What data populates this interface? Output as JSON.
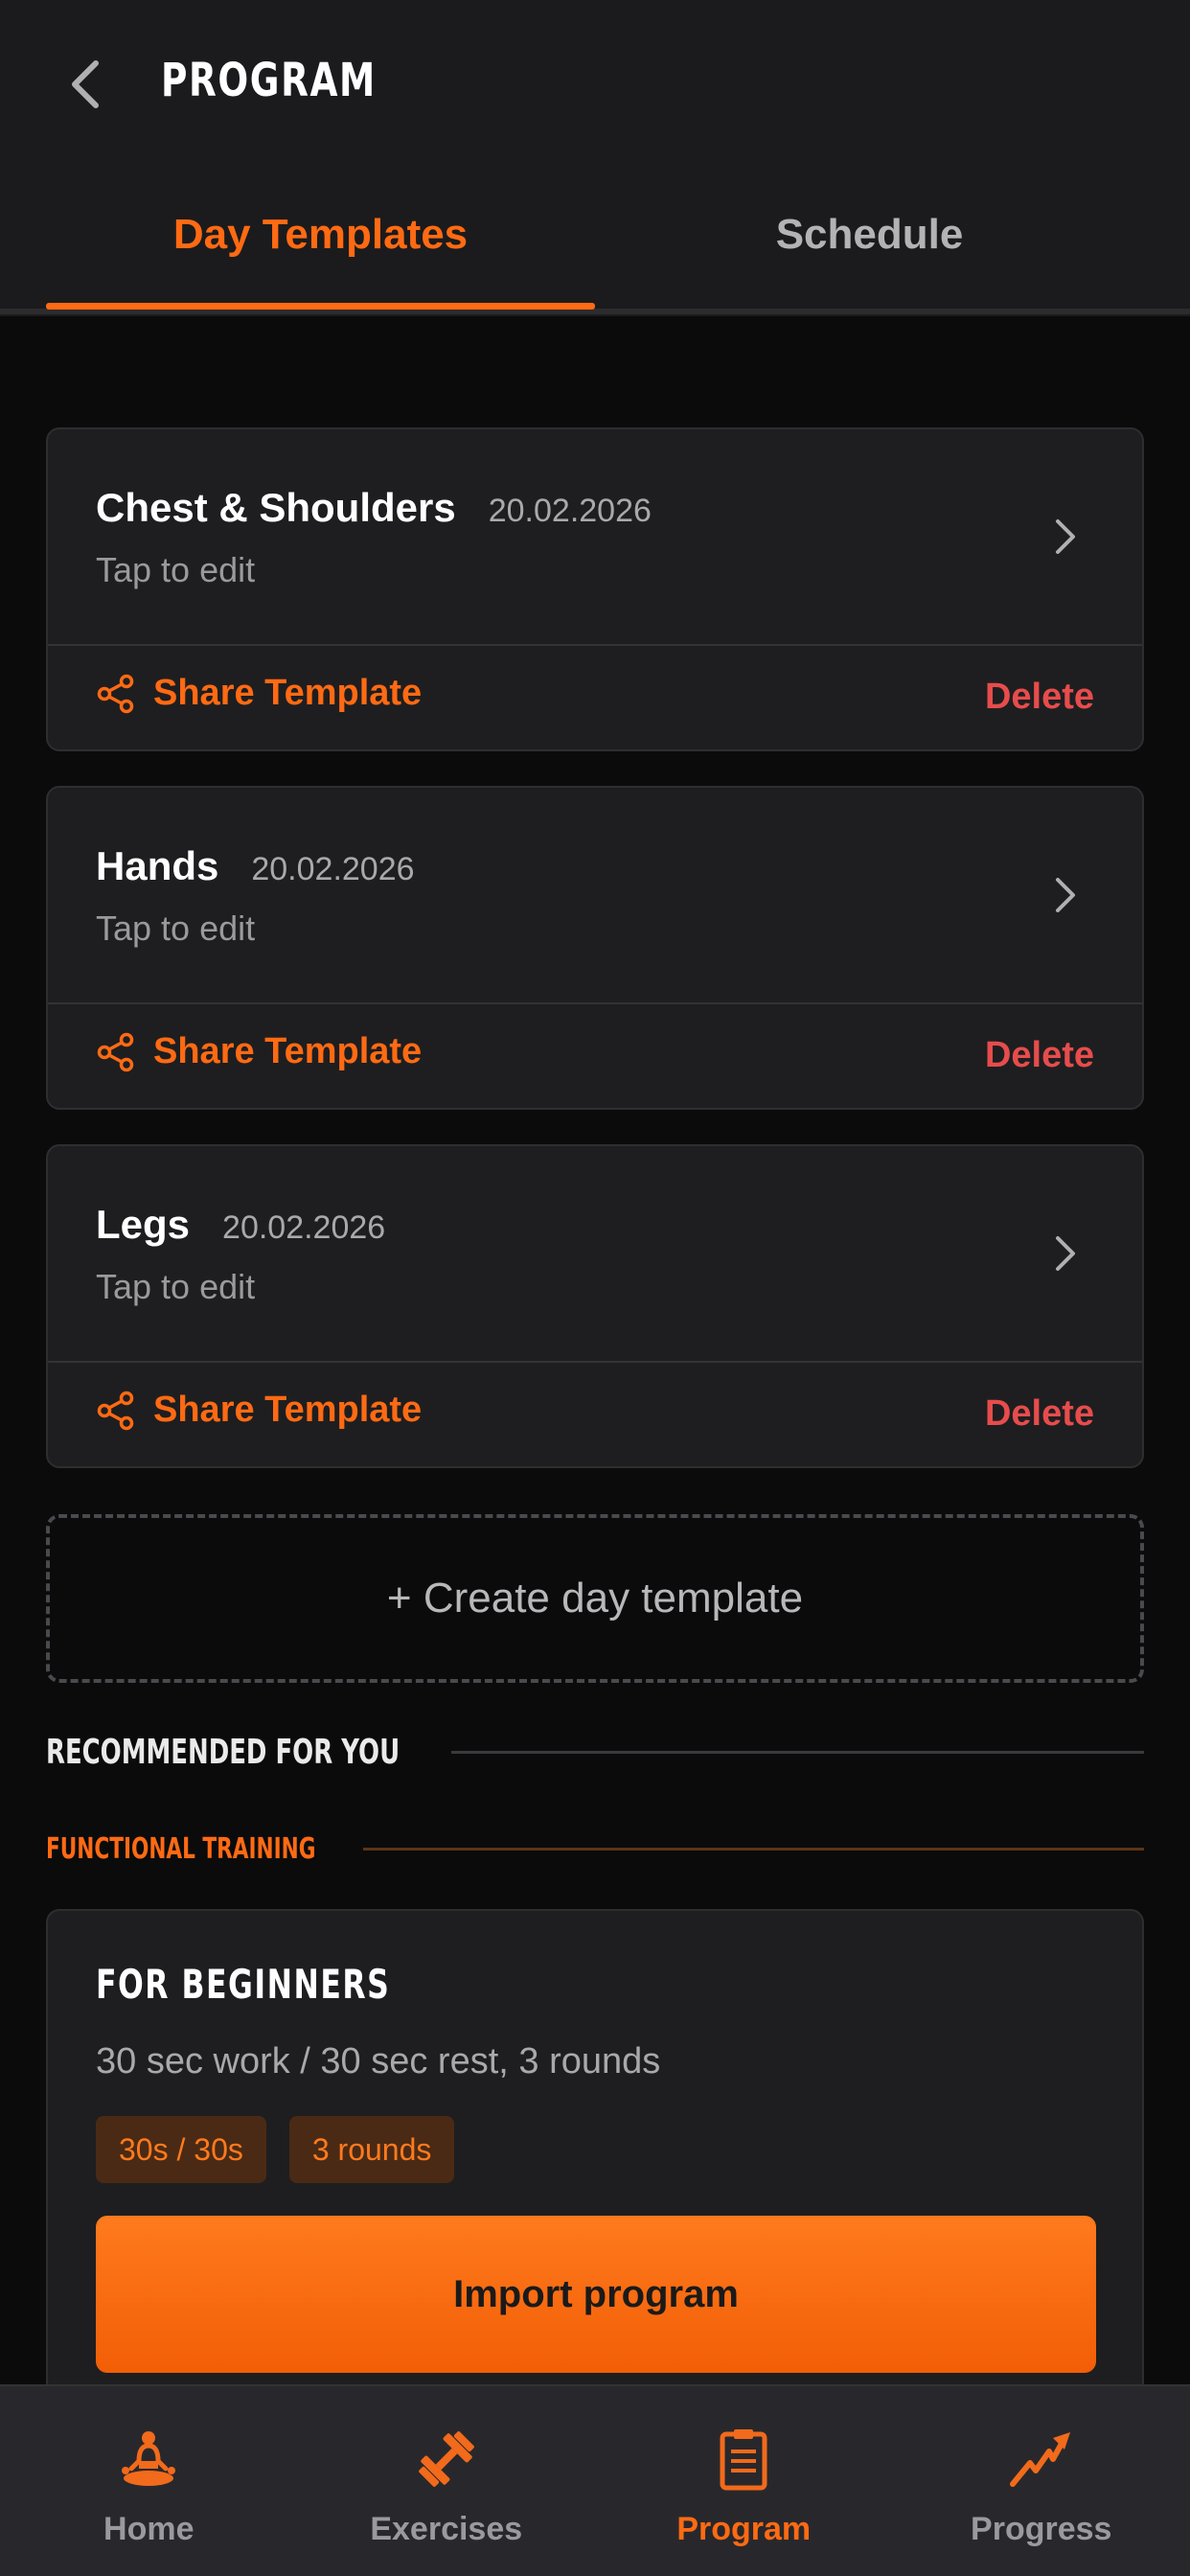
{
  "header": {
    "title": "PROGRAM"
  },
  "tabs": [
    {
      "label": "Day Templates",
      "active": true
    },
    {
      "label": "Schedule",
      "active": false
    }
  ],
  "templates": [
    {
      "name": "Chest & Shoulders",
      "date": "20.02.2026",
      "subtitle": "Tap to edit",
      "share_label": "Share Template",
      "delete_label": "Delete"
    },
    {
      "name": "Hands",
      "date": "20.02.2026",
      "subtitle": "Tap to edit",
      "share_label": "Share Template",
      "delete_label": "Delete"
    },
    {
      "name": "Legs",
      "date": "20.02.2026",
      "subtitle": "Tap to edit",
      "share_label": "Share Template",
      "delete_label": "Delete"
    }
  ],
  "create_label": "+ Create day template",
  "recommended": {
    "heading": "RECOMMENDED FOR YOU",
    "category": "FUNCTIONAL TRAINING",
    "program": {
      "title": "FOR BEGINNERS",
      "description": "30 sec work / 30 sec rest, 3 rounds",
      "chips": [
        "30s / 30s",
        "3 rounds"
      ],
      "button_label": "Import program"
    }
  },
  "nav": [
    {
      "label": "Home",
      "icon": "meditation-icon",
      "active": false
    },
    {
      "label": "Exercises",
      "icon": "dumbbell-icon",
      "active": false
    },
    {
      "label": "Program",
      "icon": "clipboard-icon",
      "active": true
    },
    {
      "label": "Progress",
      "icon": "trend-arrow-icon",
      "active": false
    }
  ],
  "colors": {
    "accent": "#ff6a13",
    "delete": "#e74c4c",
    "background": "#0b0b0c",
    "card": "#1e1e20"
  }
}
